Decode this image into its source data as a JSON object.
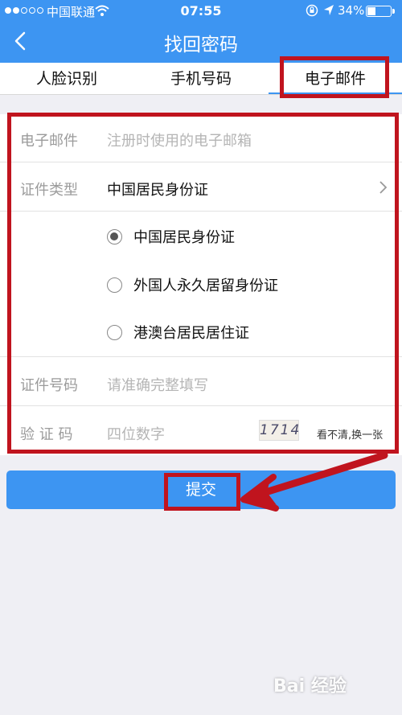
{
  "status_bar": {
    "carrier": "中国联通",
    "time": "07:55",
    "battery": "34%"
  },
  "nav": {
    "title": "找回密码"
  },
  "tabs": [
    {
      "label": "人脸识别"
    },
    {
      "label": "手机号码"
    },
    {
      "label": "电子邮件"
    }
  ],
  "form": {
    "email": {
      "label": "电子邮件",
      "placeholder": "注册时使用的电子邮箱"
    },
    "doc_type": {
      "label": "证件类型",
      "value": "中国居民身份证"
    },
    "doc_options": [
      {
        "label": "中国居民身份证",
        "checked": true
      },
      {
        "label": "外国人永久居留身份证",
        "checked": false
      },
      {
        "label": "港澳台居民居住证",
        "checked": false
      }
    ],
    "id_number": {
      "label": "证件号码",
      "placeholder": "请准确完整填写"
    },
    "captcha": {
      "label": "验 证 码",
      "placeholder": "四位数字",
      "image_text": "1714",
      "refresh": "看不清,换一张"
    }
  },
  "submit": {
    "label": "提交"
  },
  "colors": {
    "accent": "#3d95f2",
    "annotation": "#c0141e"
  },
  "watermark": {
    "text": "Bai 经验"
  }
}
